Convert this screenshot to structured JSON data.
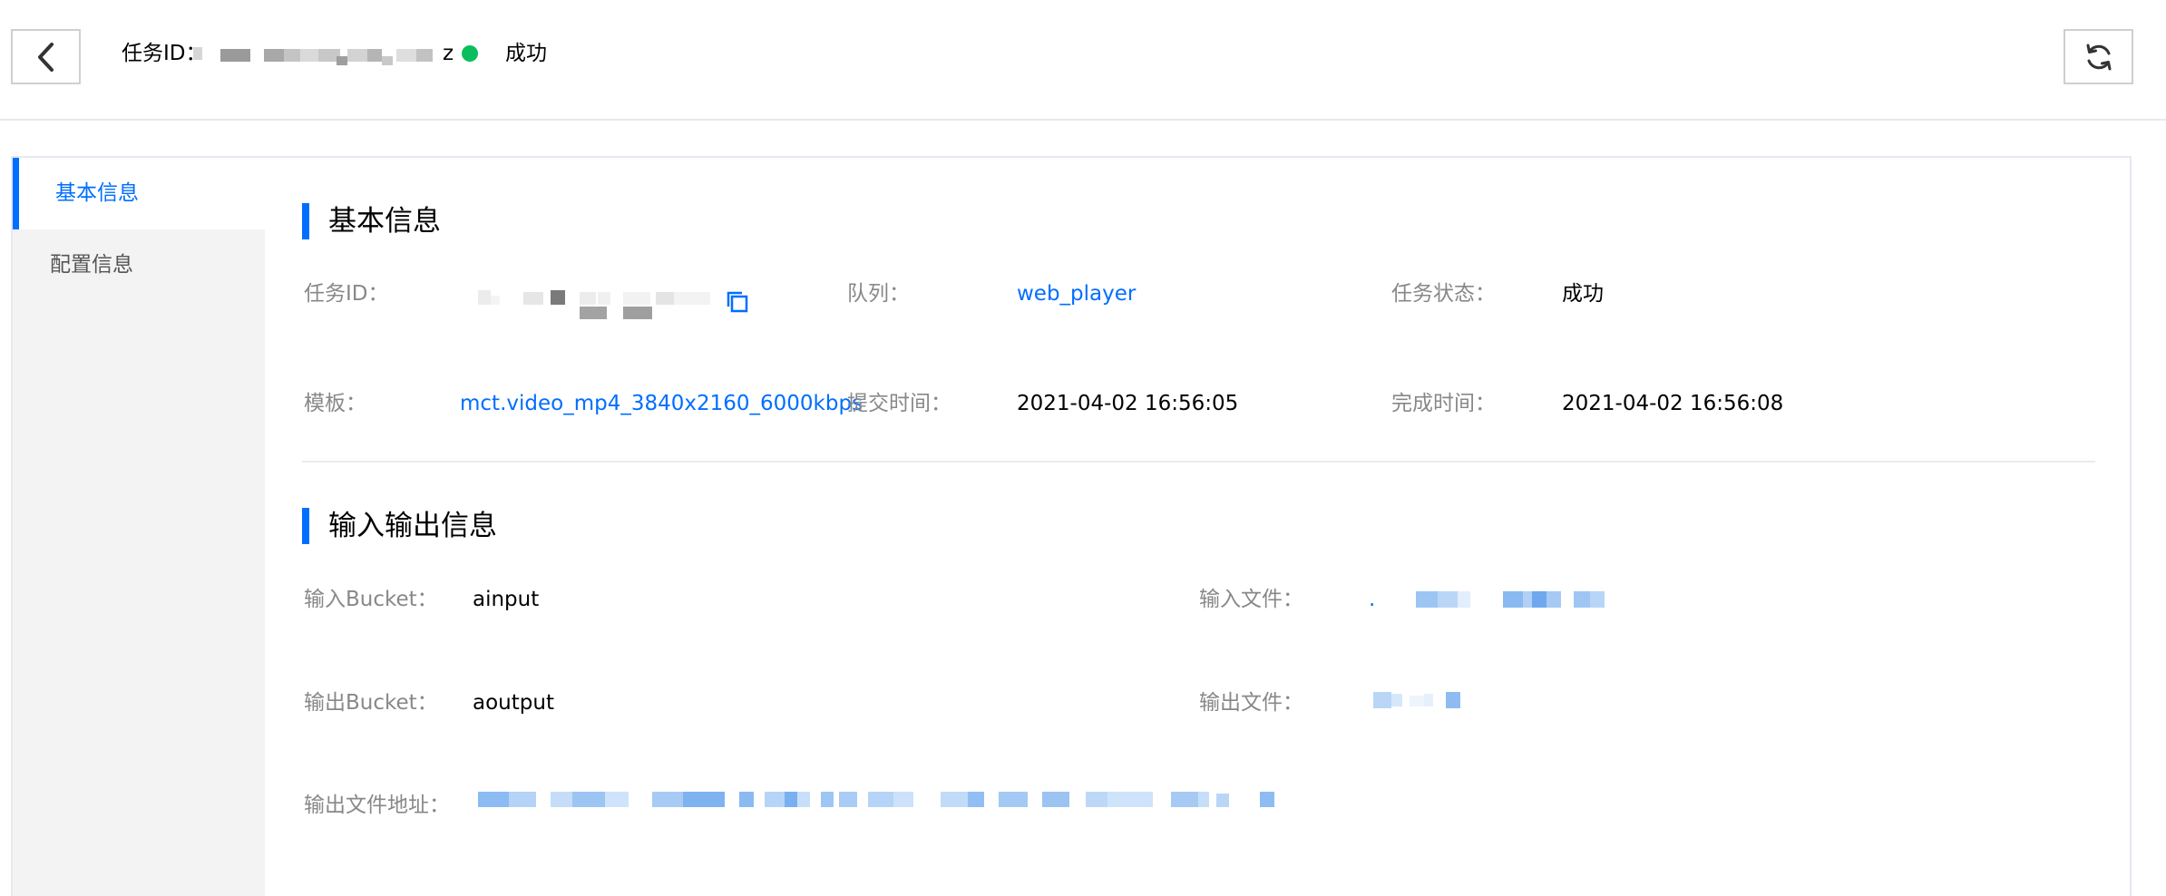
{
  "colors": {
    "accent": "#006eff",
    "success": "#0abf5b",
    "label": "#888888",
    "text": "#000000"
  },
  "header": {
    "back_icon": "chevron-left-icon",
    "task_id_label": "任务ID：",
    "task_id_suffix": "z",
    "status": "成功",
    "refresh_icon": "refresh-icon"
  },
  "sidebar": {
    "items": [
      {
        "label": "基本信息",
        "active": true
      },
      {
        "label": "配置信息",
        "active": false
      }
    ]
  },
  "basic": {
    "title": "基本信息",
    "task_id_label": "任务ID：",
    "copy_icon": "copy-icon",
    "queue_label": "队列：",
    "queue_value": "web_player",
    "status_label": "任务状态：",
    "status_value": "成功",
    "template_label": "模板：",
    "template_value": "mct.video_mp4_3840x2160_6000kbps",
    "submit_label": "提交时间：",
    "submit_value": "2021-04-02 16:56:05",
    "finish_label": "完成时间：",
    "finish_value": "2021-04-02 16:56:08"
  },
  "io": {
    "title": "输入输出信息",
    "input_bucket_label": "输入Bucket：",
    "input_bucket_value": "ainput",
    "input_file_label": "输入文件：",
    "input_file_prefix": ".",
    "output_bucket_label": "输出Bucket：",
    "output_bucket_value": "aoutput",
    "output_file_label": "输出文件：",
    "output_address_label": "输出文件地址："
  }
}
